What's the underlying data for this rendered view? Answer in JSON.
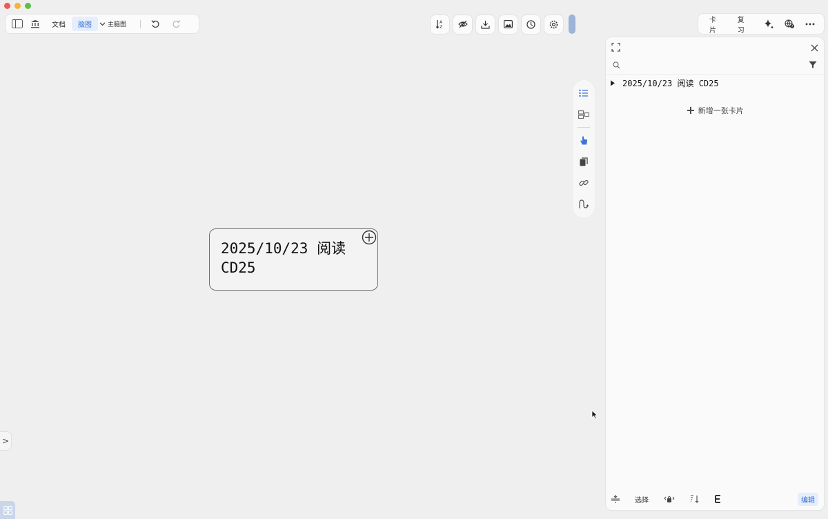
{
  "toolbar": {
    "doc_label": "文档",
    "mindmap_label": "脑图",
    "sub_label": "主脑图"
  },
  "top_right": {
    "card_label": "卡片",
    "review_label": "复习"
  },
  "node": {
    "text": "2025/10/23 阅读 CD25"
  },
  "panel": {
    "search_placeholder": "",
    "tree_item": "2025/10/23 阅读 CD25",
    "add_card_label": "新增一张卡片",
    "footer": {
      "select_label": "选择",
      "edit_label": "编辑"
    }
  },
  "left_expander_label": ">",
  "colors": {
    "accent": "#3a74d9",
    "background": "#efefef"
  }
}
